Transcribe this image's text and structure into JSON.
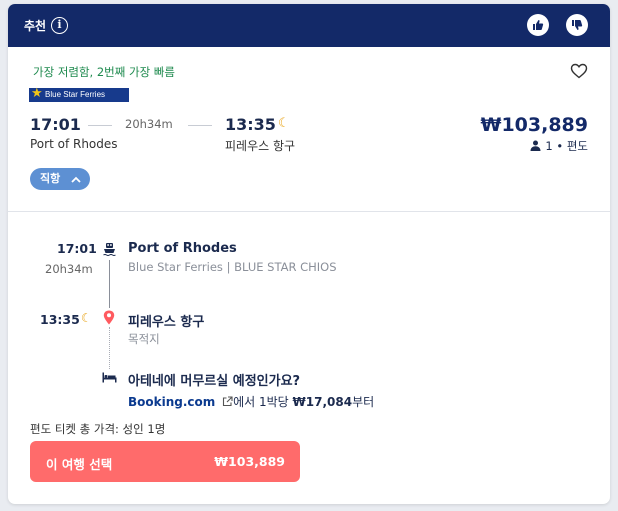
{
  "header": {
    "title": "추천",
    "info_icon": "info-icon",
    "thumbs_up_icon": "thumbs-up-icon",
    "thumbs_down_icon": "thumbs-down-icon"
  },
  "offer": {
    "tagline": "가장 저렴함, 2번째 가장 빠름",
    "operator_logo_text": "Blue Star Ferries",
    "departure_time": "17:01",
    "departure_place": "Port of Rhodes",
    "duration": "20h34m",
    "arrival_time": "13:35",
    "arrival_place": "피레우스 항구",
    "price": "₩103,889",
    "passengers": "1",
    "trip_type": "편도",
    "direct_label": "직항"
  },
  "itinerary": {
    "depart_time": "17:01",
    "duration": "20h34m",
    "depart_place": "Port of Rhodes",
    "vessel": "Blue Star Ferries | BLUE STAR CHIOS",
    "arrive_time": "13:35",
    "arrive_place": "피레우스 항구",
    "arrive_sub": "목적지"
  },
  "stay": {
    "question": "아테네에 머무르실 예정인가요?",
    "provider": "Booking.com",
    "offer_text": "에서 1박당 ",
    "nightly_price": "₩17,084",
    "suffix": "부터"
  },
  "footer": {
    "price_note": "편도 티켓 총 가격: 성인 1명",
    "select_label": "이 여행 선택",
    "select_price": "₩103,889"
  },
  "colors": {
    "header_bg": "#132968",
    "accent_green": "#1e8a4e",
    "direct_badge": "#5d90d3",
    "cta": "#ff6b6b",
    "moon": "#e8a317",
    "pin": "#ff5a5f"
  }
}
